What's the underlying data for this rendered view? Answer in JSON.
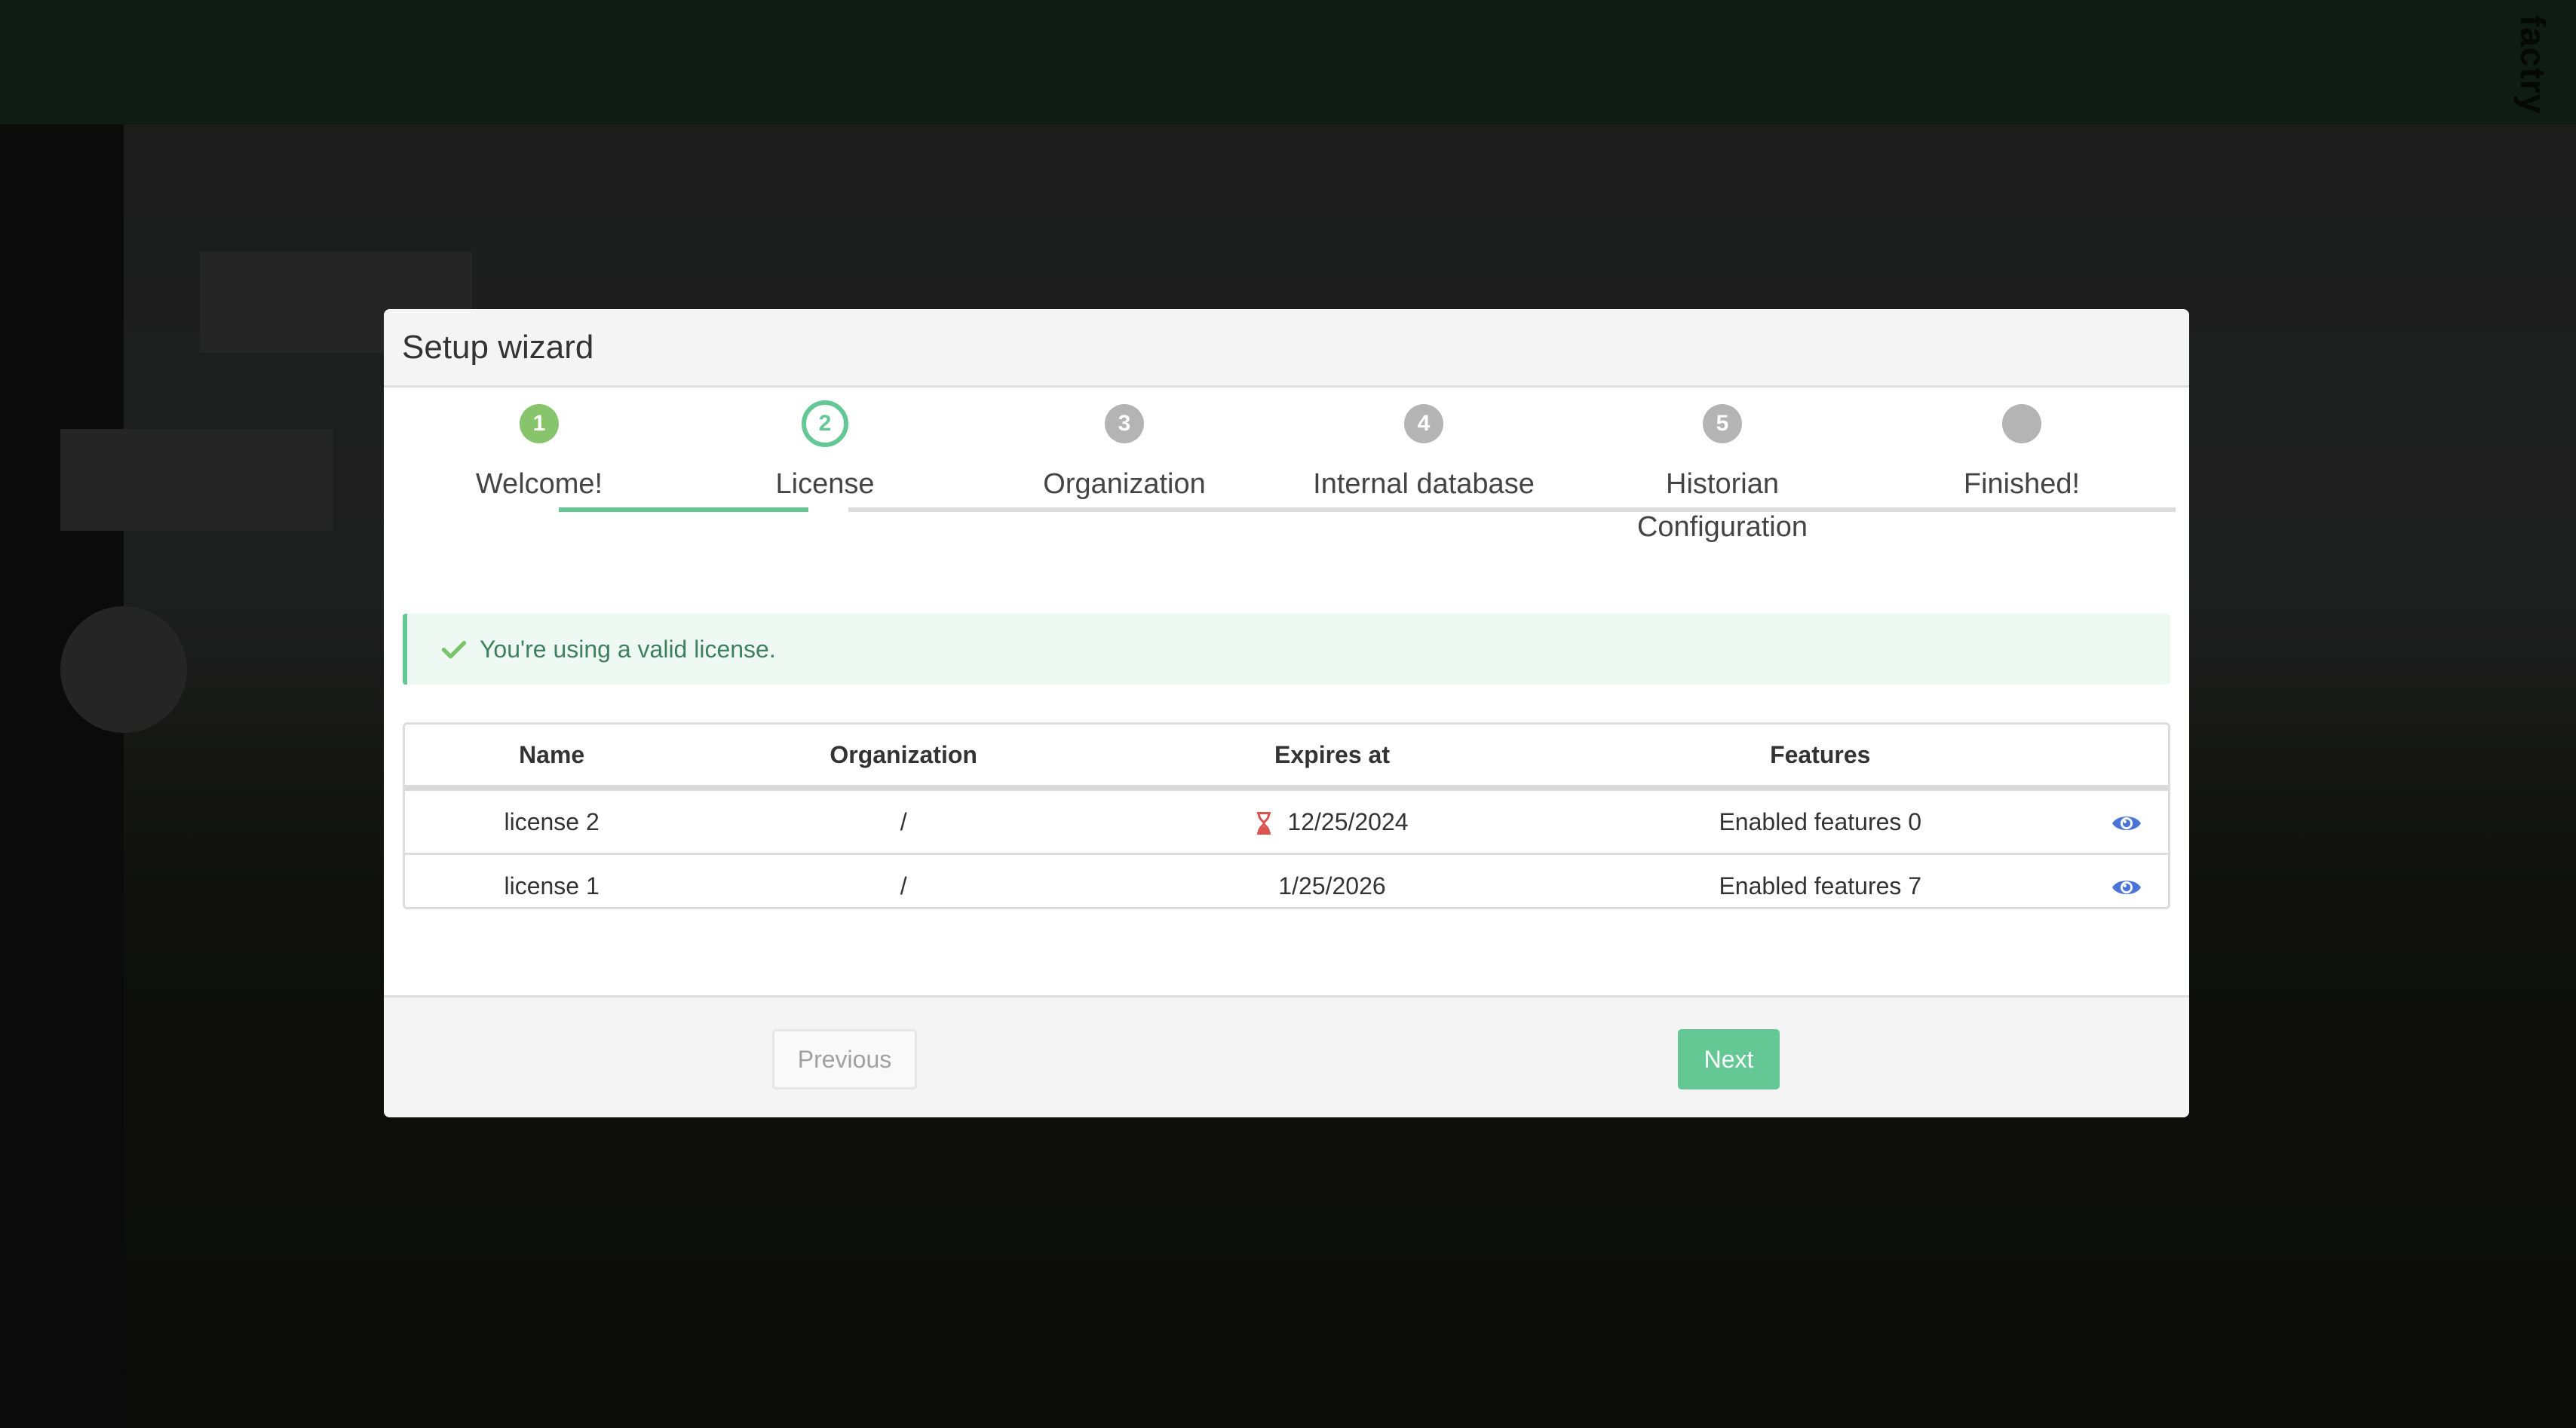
{
  "app": {
    "brand": "factry"
  },
  "modal": {
    "title": "Setup wizard",
    "steps": [
      {
        "number": "1",
        "label": "Welcome!",
        "state": "done"
      },
      {
        "number": "2",
        "label": "License",
        "state": "active"
      },
      {
        "number": "3",
        "label": "Organization",
        "state": "todo"
      },
      {
        "number": "4",
        "label": "Internal database",
        "state": "todo"
      },
      {
        "number": "5",
        "label": "Historian Configuration",
        "state": "todo"
      },
      {
        "number": "",
        "label": "Finished!",
        "state": "todo"
      }
    ],
    "alert": {
      "icon": "check-icon",
      "text": "You're using a valid license."
    },
    "table": {
      "headers": [
        "Name",
        "Organization",
        "Expires at",
        "Features",
        ""
      ],
      "rows": [
        {
          "name": "license 2",
          "organization": "/",
          "expires_at": "12/25/2024",
          "expired_icon": "hourglass-icon",
          "features": "Enabled features 0",
          "action_icon": "eye-icon"
        },
        {
          "name": "license 1",
          "organization": "/",
          "expires_at": "1/25/2026",
          "expired_icon": "",
          "features": "Enabled features 7",
          "action_icon": "eye-icon"
        }
      ]
    },
    "footer": {
      "previous_label": "Previous",
      "next_label": "Next"
    }
  },
  "colors": {
    "accent": "#63c894",
    "done": "#88c46c",
    "todo": "#b4b4b4",
    "expired": "#d9534f",
    "link": "#4a74d6"
  }
}
